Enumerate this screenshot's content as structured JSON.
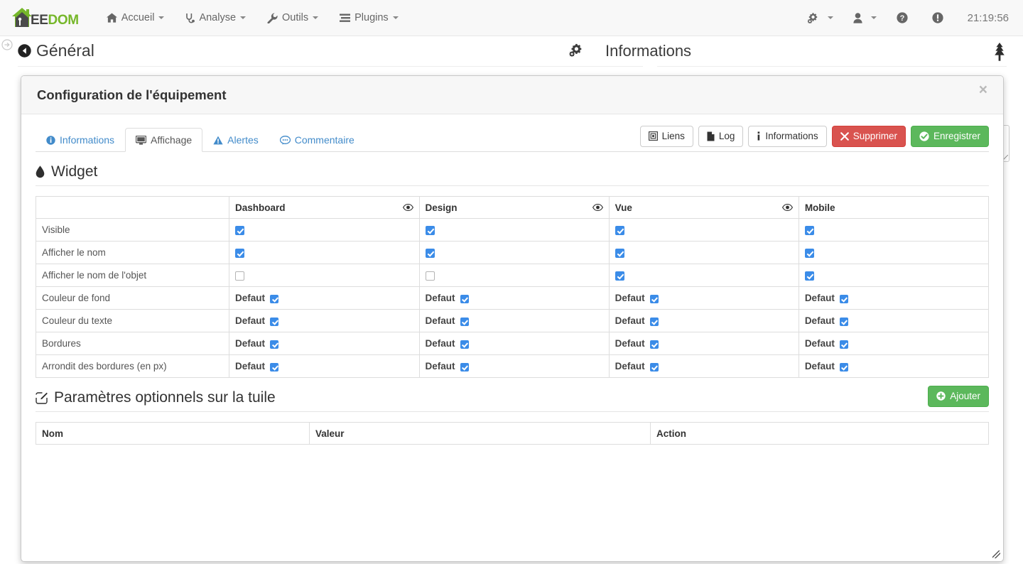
{
  "navbar": {
    "brand": {
      "prefix": "EE",
      "suffix": "DOM"
    },
    "items": [
      {
        "label": "Accueil",
        "icon": "home-icon"
      },
      {
        "label": "Analyse",
        "icon": "stethoscope-icon"
      },
      {
        "label": "Outils",
        "icon": "wrench-icon"
      },
      {
        "label": "Plugins",
        "icon": "list-icon"
      }
    ],
    "right": [
      {
        "label": "",
        "icon": "gears-icon",
        "caret": true
      },
      {
        "label": "",
        "icon": "user-icon",
        "caret": true
      },
      {
        "label": "",
        "icon": "help-icon",
        "caret": false
      },
      {
        "label": "",
        "icon": "warning-circle-icon",
        "caret": false
      }
    ],
    "clock": "21:19:56"
  },
  "page_header": {
    "back_label": "Général",
    "gear_icon": "gears-icon",
    "info_title": "Informations",
    "tree_icon": "tree-icon"
  },
  "modal": {
    "title": "Configuration de l'équipement",
    "close_label": "×",
    "tabs": [
      {
        "label": "Informations",
        "icon": "info-circle-icon",
        "active": false
      },
      {
        "label": "Affichage",
        "icon": "desktop-icon",
        "active": true
      },
      {
        "label": "Alertes",
        "icon": "warning-triangle-icon",
        "active": false
      },
      {
        "label": "Commentaire",
        "icon": "comment-icon",
        "active": false
      }
    ],
    "actions": [
      {
        "label": "Liens",
        "icon": "sitemap-icon",
        "style": "default"
      },
      {
        "label": "Log",
        "icon": "file-icon",
        "style": "default"
      },
      {
        "label": "Informations",
        "icon": "info-i-icon",
        "style": "default"
      },
      {
        "label": "Supprimer",
        "icon": "times-icon",
        "style": "danger"
      },
      {
        "label": "Enregistrer",
        "icon": "check-circle-icon",
        "style": "success"
      }
    ]
  },
  "widget_section": {
    "title": "Widget",
    "icon": "tint-icon",
    "columns": [
      {
        "label": "",
        "eye": false
      },
      {
        "label": "Dashboard",
        "eye": true
      },
      {
        "label": "Design",
        "eye": true
      },
      {
        "label": "Vue",
        "eye": true
      },
      {
        "label": "Mobile",
        "eye": false
      }
    ],
    "rows": [
      {
        "label": "Visible",
        "type": "checkbox",
        "values": [
          true,
          true,
          true,
          true
        ]
      },
      {
        "label": "Afficher le nom",
        "type": "checkbox",
        "values": [
          true,
          true,
          true,
          true
        ]
      },
      {
        "label": "Afficher le nom de l'objet",
        "type": "checkbox",
        "values": [
          false,
          false,
          true,
          true
        ]
      },
      {
        "label": "Couleur de fond",
        "type": "default",
        "text": "Defaut",
        "values": [
          true,
          true,
          true,
          true
        ]
      },
      {
        "label": "Couleur du texte",
        "type": "default",
        "text": "Defaut",
        "values": [
          true,
          true,
          true,
          true
        ]
      },
      {
        "label": "Bordures",
        "type": "default",
        "text": "Defaut",
        "values": [
          true,
          true,
          true,
          true
        ]
      },
      {
        "label": "Arrondit des bordures (en px)",
        "type": "default",
        "text": "Defaut",
        "values": [
          true,
          true,
          true,
          true
        ]
      }
    ]
  },
  "params_section": {
    "title": "Paramètres optionnels sur la tuile",
    "icon": "edit-icon",
    "add_button": {
      "label": "Ajouter",
      "icon": "plus-circle-icon"
    },
    "columns": [
      "Nom",
      "Valeur",
      "Action"
    ],
    "rows": []
  },
  "colors": {
    "brand_green": "#76b72a",
    "accent_blue": "#428bca",
    "checkbox_blue": "#3b8ce8",
    "danger_red": "#d9534f",
    "success_green": "#5cb85c"
  }
}
